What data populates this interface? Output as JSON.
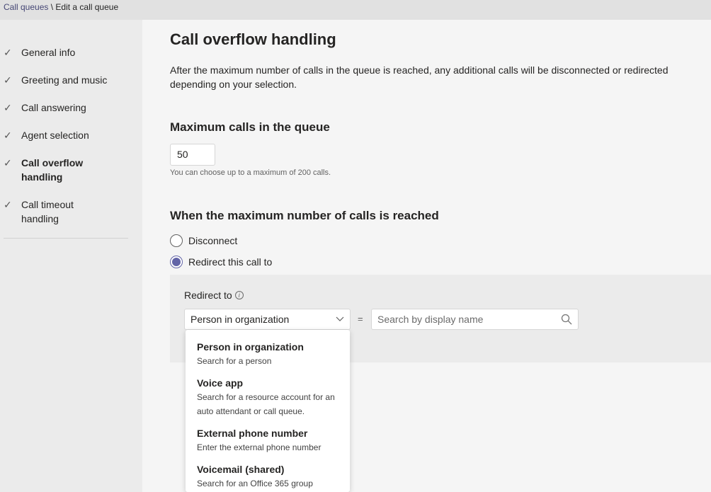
{
  "breadcrumb": {
    "link": "Call queues",
    "separator": " \\ ",
    "current": "Edit a call queue"
  },
  "sidebar": {
    "items": [
      {
        "label": "General info",
        "icon": "checkmark-icon"
      },
      {
        "label": "Greeting and music",
        "icon": "checkmark-icon"
      },
      {
        "label": "Call answering",
        "icon": "checkmark-icon"
      },
      {
        "label": "Agent selection",
        "icon": "checkmark-icon"
      },
      {
        "label": "Call overflow handling",
        "icon": "checkmark-icon",
        "active": true
      },
      {
        "label": "Call timeout handling",
        "icon": "checkmark-icon"
      }
    ]
  },
  "main": {
    "title": "Call overflow handling",
    "description": "After the maximum number of calls in the queue is reached, any additional calls will be disconnected or redirected depending on your selection.",
    "max_calls": {
      "heading": "Maximum calls in the queue",
      "value": "50",
      "hint": "You can choose up to a maximum of 200 calls."
    },
    "reached": {
      "heading": "When the maximum number of calls is reached",
      "options": [
        {
          "label": "Disconnect",
          "checked": false
        },
        {
          "label": "Redirect this call to",
          "checked": true
        }
      ]
    },
    "redirect": {
      "label": "Redirect to",
      "select_value": "Person in organization",
      "equals": "=",
      "search_placeholder": "Search by display name"
    },
    "dropdown": {
      "options": [
        {
          "title": "Person in organization",
          "subtitle": "Search for a person"
        },
        {
          "title": "Voice app",
          "subtitle": "Search for a resource account for an auto attendant or call queue."
        },
        {
          "title": "External phone number",
          "subtitle": "Enter the external phone number"
        },
        {
          "title": "Voicemail (shared)",
          "subtitle": "Search for an Office 365 group"
        }
      ]
    }
  },
  "colors": {
    "accent": "#6264a7",
    "sidebar_bg": "#ebebeb",
    "page_bg": "#f5f5f5"
  }
}
